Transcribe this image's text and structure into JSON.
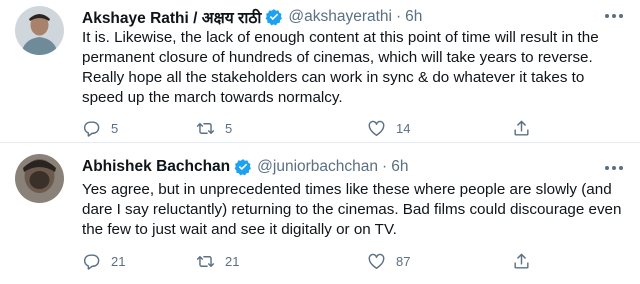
{
  "tweets": [
    {
      "name": "Akshaye Rathi / अक्षय राठी",
      "handle": "@akshayerathi",
      "separator": "·",
      "time": "6h",
      "text": "It is. Likewise, the lack of enough content at this point of time will result in the permanent closure of hundreds of cinemas, which will take years to reverse. Really hope all the stakeholders can work in sync & do whatever it takes to speed up the march towards normalcy.",
      "replies": "5",
      "retweets": "5",
      "likes": "14"
    },
    {
      "name": "Abhishek Bachchan",
      "handle": "@juniorbachchan",
      "separator": "·",
      "time": "6h",
      "text": "Yes agree, but in unprecedented times like these where people are slowly (and dare I say reluctantly) returning to the cinemas. Bad films could discourage even the few to just wait and see it digitally or on TV.",
      "replies": "21",
      "retweets": "21",
      "likes": "87"
    }
  ],
  "colors": {
    "verified": "#1da1f2",
    "secondary_text": "#5b7083",
    "primary_text": "#0f1419",
    "divider": "#e6ecf0"
  },
  "icons": [
    "verified-badge-icon",
    "more-icon",
    "reply-icon",
    "retweet-icon",
    "like-icon",
    "share-icon"
  ]
}
